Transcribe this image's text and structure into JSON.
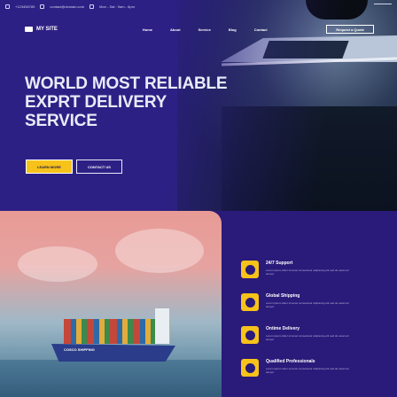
{
  "topbar": {
    "phone": "+123456789",
    "email": "contact@domain.com",
    "hours": "Mon - Sat : 9am - 6pm"
  },
  "nav": {
    "brand": "MY SITE",
    "items": [
      "Home",
      "About",
      "Service",
      "Blog",
      "Contact"
    ],
    "cta": "Request a Quote"
  },
  "hero": {
    "title_line1": "WORLD MOST RELIABLE",
    "title_line2": "EXPRT DELIVERY",
    "title_line3": "SERVICE",
    "btn_primary": "LEARN MORE",
    "btn_secondary": "CONTACT US"
  },
  "ship": {
    "label": "COSCO SHIPPING"
  },
  "features": [
    {
      "title": "24/7 Support",
      "desc": "Lorem ipsum dolor sit amet consectetur adipiscing elit sed do eiusmod tempor",
      "icon": "support-icon"
    },
    {
      "title": "Global Shipping",
      "desc": "Lorem ipsum dolor sit amet consectetur adipiscing elit sed do eiusmod tempor",
      "icon": "globe-icon"
    },
    {
      "title": "Ontime Delivery",
      "desc": "Lorem ipsum dolor sit amet consectetur adipiscing elit sed do eiusmod tempor",
      "icon": "clock-icon"
    },
    {
      "title": "Qualified Professionals",
      "desc": "Lorem ipsum dolor sit amet consectetur adipiscing elit sed do eiusmod tempor",
      "icon": "user-icon"
    }
  ],
  "colors": {
    "brand_purple": "#2a1a7a",
    "accent_yellow": "#f7c21a"
  }
}
